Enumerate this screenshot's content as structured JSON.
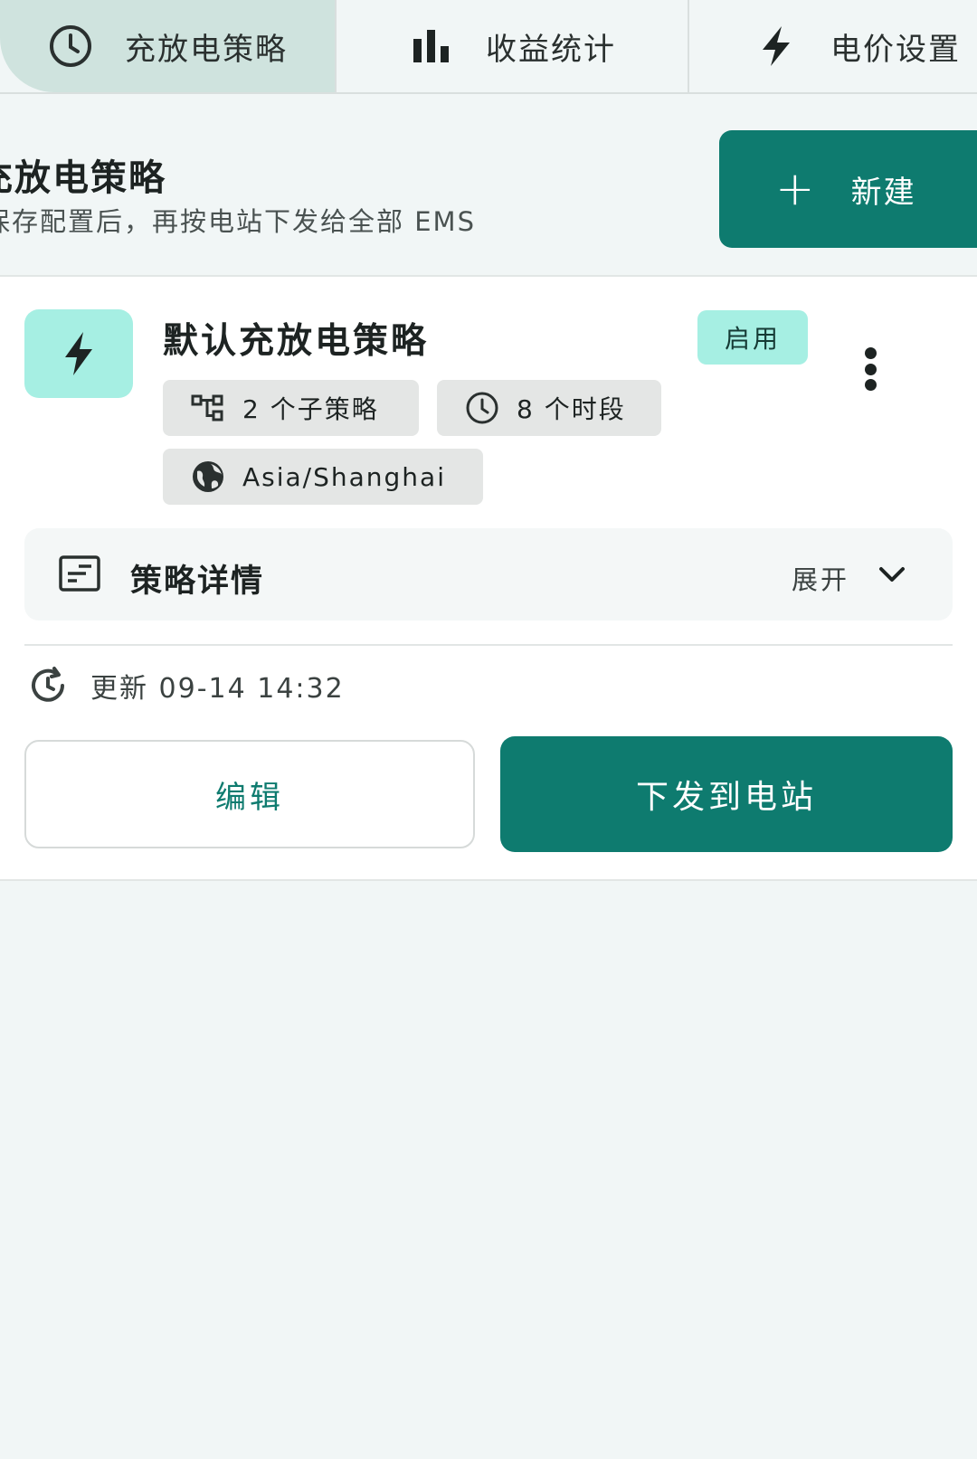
{
  "tabs": [
    {
      "label": "充放电策略",
      "icon": "clock-icon",
      "active": true
    },
    {
      "label": "收益统计",
      "icon": "bar-chart-icon",
      "active": false
    },
    {
      "label": "电价设置",
      "icon": "bolt-icon",
      "active": false
    }
  ],
  "header": {
    "title": "充放电策略",
    "subtitle": "保存配置后，再按电站下发给全部 EMS",
    "new_button": "新建"
  },
  "strategy": {
    "name": "默认充放电策略",
    "status": "启用",
    "chips": {
      "substrategies": "2 个子策略",
      "periods": "8 个时段",
      "timezone": "Asia/Shanghai"
    },
    "details_label": "策略详情",
    "expand_label": "展开",
    "updated": "更新 09-14 14:32",
    "edit_button": "编辑",
    "push_button": "下发到电站"
  },
  "colors": {
    "primary": "#0e7b6f",
    "accent": "#a6efe3",
    "active_tab": "#cfe3de",
    "background": "#f1f6f6"
  }
}
